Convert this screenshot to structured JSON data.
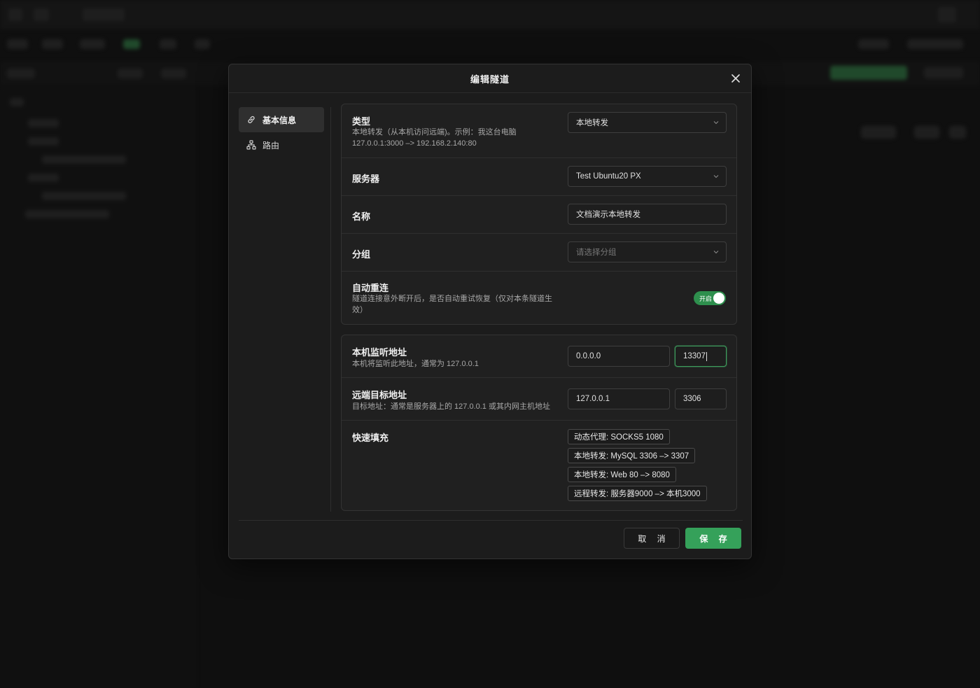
{
  "modal": {
    "title": "编辑隧道",
    "nav": [
      {
        "label": "基本信息",
        "icon": "link-icon",
        "active": true
      },
      {
        "label": "路由",
        "icon": "network-icon",
        "active": false
      }
    ]
  },
  "basic": {
    "type": {
      "label": "类型",
      "desc": "本地转发（从本机访问远端)。示例：我这台电脑 127.0.0.1:3000 –> 192.168.2.140:80",
      "value": "本地转发"
    },
    "server": {
      "label": "服务器",
      "value": "Test Ubuntu20 PX"
    },
    "name": {
      "label": "名称",
      "value": "文档演示本地转发"
    },
    "group": {
      "label": "分组",
      "placeholder": "请选择分组"
    },
    "auto_reconnect": {
      "label": "自动重连",
      "desc": "隧道连接意外断开后，是否自动重试恢复（仅对本条隧道生效）",
      "toggle_text": "开启",
      "enabled": true
    }
  },
  "addresses": {
    "local": {
      "label": "本机监听地址",
      "desc": "本机将监听此地址，通常为 127.0.0.1",
      "host": "0.0.0.0",
      "port": "13307"
    },
    "remote": {
      "label": "远端目标地址",
      "desc": "目标地址：通常是服务器上的 127.0.0.1 或其内网主机地址",
      "host": "127.0.0.1",
      "port": "3306"
    },
    "quick_fill": {
      "label": "快速填充",
      "chips": [
        "动态代理: SOCKS5 1080",
        "本地转发: MySQL 3306 –> 3307",
        "本地转发: Web 80 –> 8080",
        "远程转发: 服务器9000 –> 本机3000"
      ]
    }
  },
  "footer": {
    "cancel": "取 消",
    "save": "保 存"
  },
  "colors": {
    "accent": "#35a15a",
    "background": "#1c1c1c",
    "card": "#202020"
  }
}
